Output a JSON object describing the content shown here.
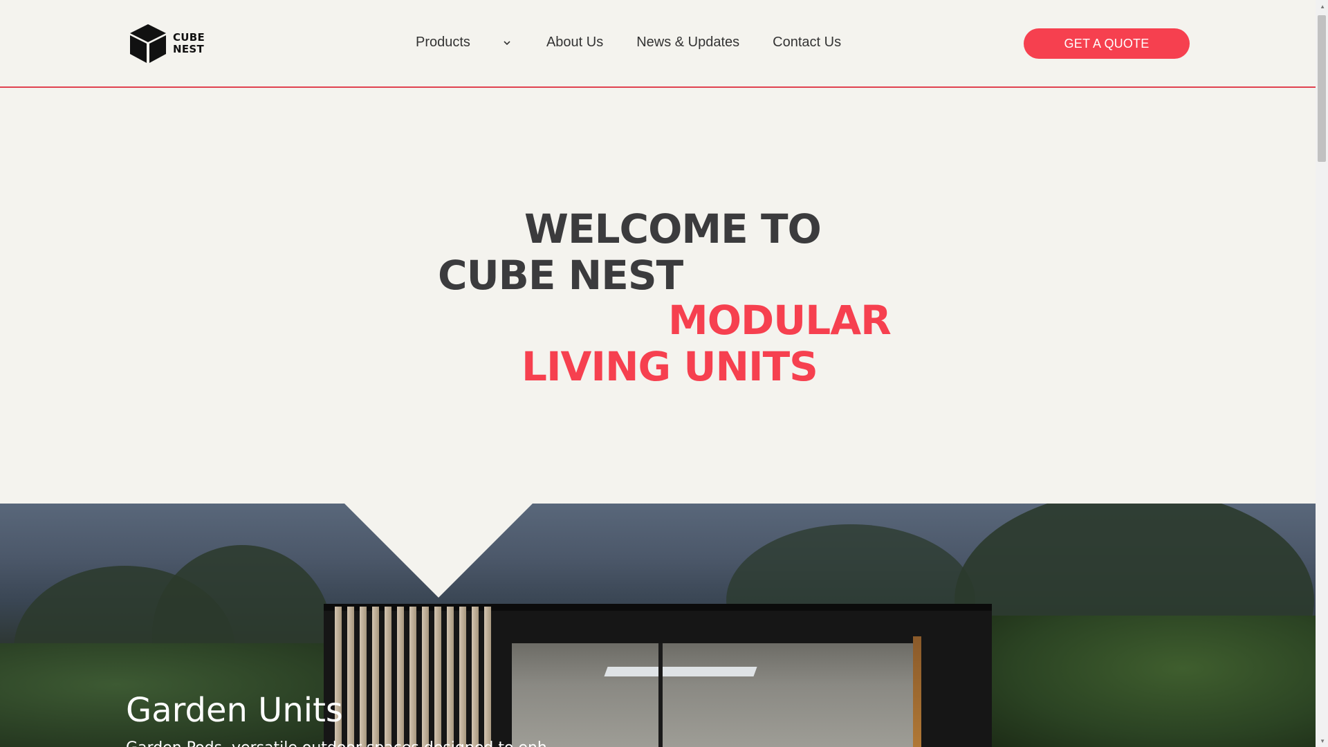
{
  "brand": {
    "line1": "CUBE",
    "line2": "NEST"
  },
  "nav": {
    "products": "Products",
    "about": "About Us",
    "news": "News & Updates",
    "contact": "Contact Us"
  },
  "cta": {
    "label": "GET A QUOTE"
  },
  "hero": {
    "line1": "WELCOME TO",
    "line2": "CUBE NEST",
    "line3": "MODULAR",
    "line4": "LIVING UNITS"
  },
  "section": {
    "title": "Garden Units",
    "subtitle": "Garden Pods, versatile outdoor spaces designed to enh"
  },
  "colors": {
    "accent": "#f6404f",
    "background": "#f4f3ee",
    "text": "#3b3b3d"
  },
  "icons": {
    "logo": "cube-icon",
    "dropdown": "chevron-down-icon"
  }
}
